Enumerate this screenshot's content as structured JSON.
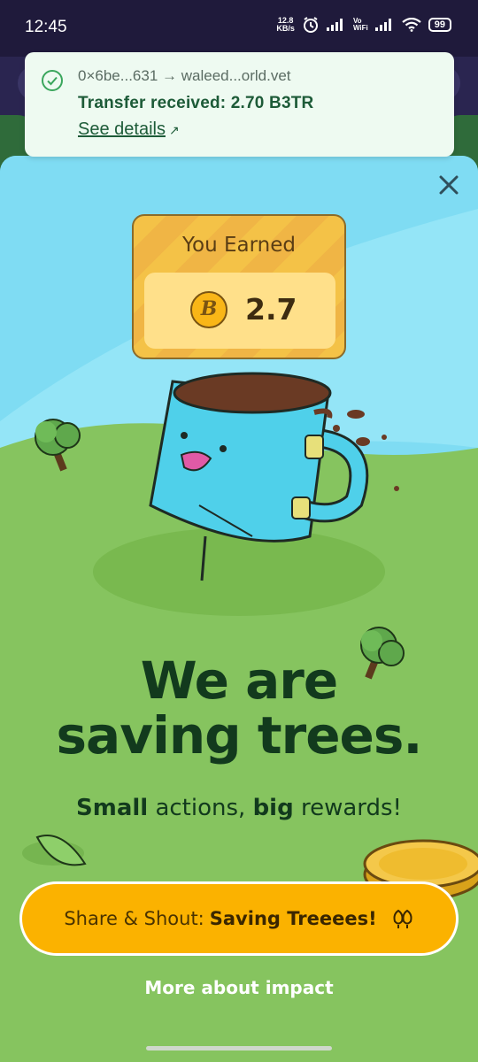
{
  "status_bar": {
    "time": "12:45",
    "net_speed_value": "12.8",
    "net_speed_unit": "KB/s",
    "vowifi_top": "Vo",
    "vowifi_bottom": "WiFi",
    "battery": "99",
    "icons": [
      "alarm-icon",
      "signal-icon",
      "vowifi-icon",
      "wifi-icon",
      "battery-icon"
    ]
  },
  "notification": {
    "route": "0×6be...631 → waleed...orld.vet",
    "message": "Transfer received: 2.70 B3TR",
    "link_label": "See details",
    "link_icon": "↗",
    "status_color": "#3aa65c"
  },
  "reward": {
    "title": "You Earned",
    "token_symbol": "B",
    "amount": "2.7"
  },
  "headline": {
    "line1": "We are",
    "line2": "saving trees."
  },
  "subline": {
    "bold1": "Small",
    "text1": " actions, ",
    "bold2": "big",
    "text2": " rewards!"
  },
  "share_button": {
    "prefix": "Share & Shout: ",
    "emphasis": "Saving Treeees!",
    "icon": "trees-icon",
    "color": "#fbb200"
  },
  "more_link": {
    "label": "More about impact"
  },
  "colors": {
    "sky": "#7fdcf3",
    "grass": "#86c45f",
    "headline": "#123a1d"
  }
}
